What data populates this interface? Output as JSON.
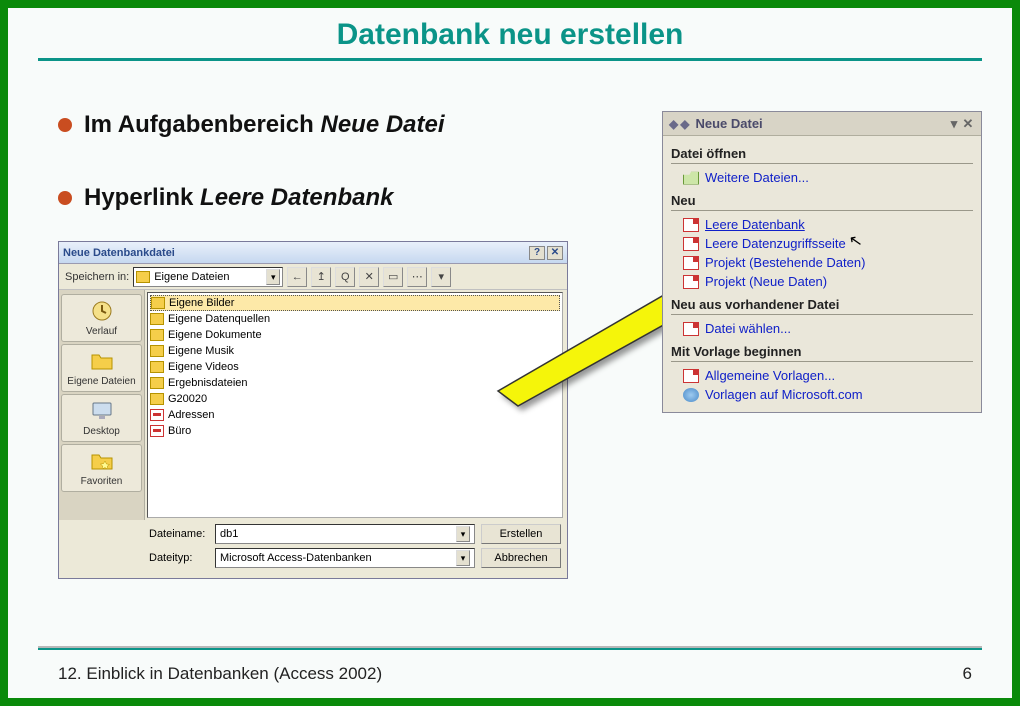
{
  "slide": {
    "title": "Datenbank neu erstellen",
    "footer_left": "12. Einblick in Datenbanken (Access 2002)",
    "footer_right": "6"
  },
  "bullets": {
    "b1a": "Im Aufgabenbereich ",
    "b1b": "Neue Datei",
    "b2a": "Hyperlink ",
    "b2b": "Leere Datenbank"
  },
  "dialog": {
    "title": "Neue Datenbankdatei",
    "savein_label": "Speichern in:",
    "savein_value": "Eigene Dateien",
    "toolbar": {
      "back": "←",
      "up": "↥",
      "search": "Q",
      "del": "✕",
      "new": "▭",
      "views": "⋯",
      "more": "▾"
    },
    "sidebar": [
      {
        "label": "Verlauf",
        "ico": "clock"
      },
      {
        "label": "Eigene Dateien",
        "ico": "folder"
      },
      {
        "label": "Desktop",
        "ico": "desktop"
      },
      {
        "label": "Favoriten",
        "ico": "star"
      }
    ],
    "files": [
      {
        "name": "Eigene Bilder",
        "type": "folder",
        "sel": true
      },
      {
        "name": "Eigene Datenquellen",
        "type": "folder"
      },
      {
        "name": "Eigene Dokumente",
        "type": "folder"
      },
      {
        "name": "Eigene Musik",
        "type": "folder"
      },
      {
        "name": "Eigene Videos",
        "type": "folder"
      },
      {
        "name": "Ergebnisdateien",
        "type": "folder"
      },
      {
        "name": "G20020",
        "type": "folder"
      },
      {
        "name": "Adressen",
        "type": "db"
      },
      {
        "name": "Büro",
        "type": "db"
      }
    ],
    "filename_label": "Dateiname:",
    "filename_value": "db1",
    "filetype_label": "Dateityp:",
    "filetype_value": "Microsoft Access-Datenbanken",
    "btn_create": "Erstellen",
    "btn_cancel": "Abbrechen"
  },
  "taskpane": {
    "title": "Neue Datei",
    "sections": {
      "open": {
        "heading": "Datei öffnen",
        "links": [
          {
            "text": "Weitere Dateien...",
            "ico": "open"
          }
        ]
      },
      "neu": {
        "heading": "Neu",
        "links": [
          {
            "text": "Leere Datenbank",
            "ico": "sheet",
            "u": true,
            "cursor": true
          },
          {
            "text": "Leere Datenzugriffsseite",
            "ico": "sheet"
          },
          {
            "text": "Projekt (Bestehende Daten)",
            "ico": "sheet"
          },
          {
            "text": "Projekt (Neue Daten)",
            "ico": "sheet"
          }
        ]
      },
      "existing": {
        "heading": "Neu aus vorhandener Datei",
        "links": [
          {
            "text": "Datei wählen...",
            "ico": "sheet"
          }
        ]
      },
      "template": {
        "heading": "Mit Vorlage beginnen",
        "links": [
          {
            "text": "Allgemeine Vorlagen...",
            "ico": "sheet"
          },
          {
            "text": "Vorlagen auf Microsoft.com",
            "ico": "globe"
          }
        ]
      }
    }
  }
}
